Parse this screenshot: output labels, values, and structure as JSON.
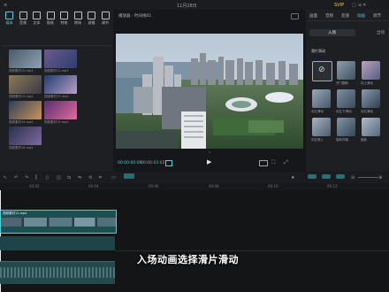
{
  "title_bar": {
    "date": "11月28日",
    "vip": "SVIP"
  },
  "left_toolbar": {
    "items": [
      {
        "label": "媒体",
        "icon": "media-icon",
        "active": true
      },
      {
        "label": "音频",
        "icon": "audio-icon"
      },
      {
        "label": "文本",
        "icon": "text-icon"
      },
      {
        "label": "贴纸",
        "icon": "sticker-icon"
      },
      {
        "label": "特效",
        "icon": "effects-icon"
      },
      {
        "label": "转场",
        "icon": "transition-icon"
      },
      {
        "label": "滤镜",
        "icon": "filter-icon"
      },
      {
        "label": "调节",
        "icon": "adjust-icon"
      }
    ]
  },
  "media": {
    "items": [
      {
        "caption": "视频素材10.mp4"
      },
      {
        "caption": "视频素材11.mp4"
      },
      {
        "caption": "视频素材12.mp4"
      },
      {
        "caption": "视频素材13.mp4"
      },
      {
        "caption": "视频素材14.mp4"
      },
      {
        "caption": "视频素材15.mp4"
      },
      {
        "caption": "视频素材16.mp4"
      }
    ]
  },
  "player": {
    "title": "播放器 - 时间线01",
    "time_current": "00:00:00:00",
    "time_total": "00:00:03:02"
  },
  "right_panel": {
    "tabs": [
      "画面",
      "音频",
      "变速",
      "动画",
      "调节"
    ],
    "active_tab": "动画",
    "subtabs": [
      "入场",
      "出场"
    ],
    "section_label": "滑片滑动",
    "effects": [
      {
        "caption": ""
      },
      {
        "caption": "开门翻转"
      },
      {
        "caption": "向上滑动"
      },
      {
        "caption": "向左滑动"
      },
      {
        "caption": "向左下滑动"
      },
      {
        "caption": "向右滑动"
      },
      {
        "caption": "向左甩入"
      },
      {
        "caption": "旋转开幕"
      },
      {
        "caption": "缩放"
      }
    ]
  },
  "timeline": {
    "ruler": [
      "00:00",
      "00:02",
      "00:04",
      "00:06",
      "00:08",
      "00:10",
      "00:12"
    ],
    "clip_label": "视频素材12.mp4"
  },
  "subtitle": "入场动画选择滑片滑动",
  "colors": {
    "accent": "#4fd1d9",
    "bg": "#17181b",
    "panel": "#1e1f23"
  }
}
